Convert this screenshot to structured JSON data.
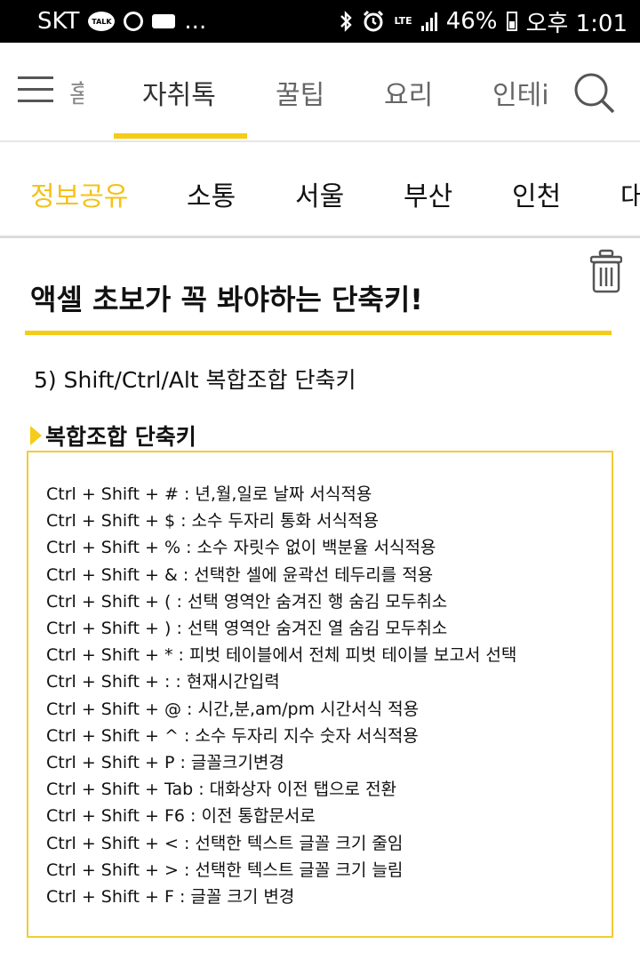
{
  "status_bar": {
    "carrier": "SKT",
    "talk_badge": "TALK",
    "more": "...",
    "network": "LTE",
    "battery": "46%",
    "time": "오후 1:01"
  },
  "nav": {
    "prev_tab_fragment": "홈",
    "tabs": [
      {
        "label": "자취톡"
      },
      {
        "label": "꿀팁"
      },
      {
        "label": "요리"
      },
      {
        "label": "인테i"
      }
    ]
  },
  "categories": [
    {
      "label": "정보공유"
    },
    {
      "label": "소통"
    },
    {
      "label": "서울"
    },
    {
      "label": "부산"
    },
    {
      "label": "인천"
    },
    {
      "label": "대"
    }
  ],
  "post": {
    "title": "액셀 초보가 꼭 봐야하는 단축키!",
    "section_heading": "5) Shift/Ctrl/Alt 복합조합 단축키",
    "sub_heading": "복합조합 단축키",
    "shortcuts": [
      "Ctrl + Shift + # : 년,월,일로 날짜 서식적용",
      "Ctrl + Shift + $ : 소수 두자리 통화 서식적용",
      "Ctrl + Shift + % : 소수 자릿수 없이 백분율  서식적용",
      "Ctrl + Shift + & : 선택한 셀에 윤곽선 테두리를 적용",
      "Ctrl + Shift + ( : 선택 영역안 숨겨진 행 숨김 모두취소",
      "Ctrl + Shift + ) : 선택 영역안 숨겨진 열 숨김 모두취소",
      "Ctrl + Shift + * : 피벗 테이블에서 전체 피벗 테이블 보고서 선택",
      "Ctrl + Shift + : : 현재시간입력",
      "Ctrl + Shift + @ : 시간,분,am/pm 시간서식 적용",
      "Ctrl + Shift + ^ : 소수 두자리 지수 숫자 서식적용",
      "Ctrl + Shift + P : 글꼴크기변경",
      "Ctrl + Shift + Tab : 대화상자 이전 탭으로 전환",
      "Ctrl + Shift + F6 : 이전 통합문서로",
      "Ctrl + Shift + < : 선택한 텍스트 글꼴 크기 줄임",
      "Ctrl + Shift + > : 선택한 텍스트 글꼴 크기 늘림",
      "Ctrl + Shift + F : 글꼴 크기 변경"
    ]
  },
  "colors": {
    "accent": "#f5cc17",
    "status_bar_bg": "#000000"
  }
}
